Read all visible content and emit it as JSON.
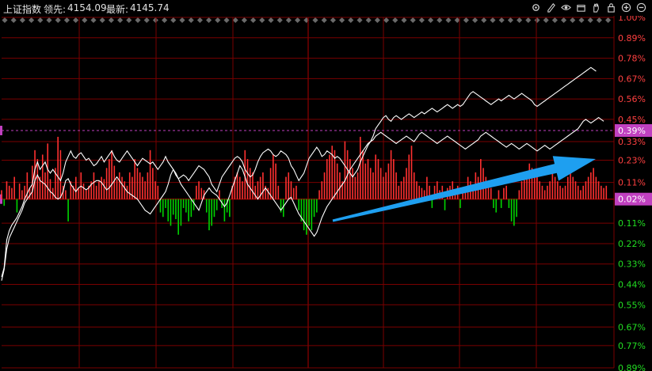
{
  "header": {
    "index_name": "上证指数",
    "lead_label": "领先:",
    "lead_value": "4154.09",
    "latest_label": "最新:",
    "latest_value": "4145.74"
  },
  "toolbar": {
    "icons": [
      "settings-icon",
      "pen-icon",
      "eye-icon",
      "box-icon",
      "hand-icon",
      "lock-icon",
      "zoom-in-icon",
      "zoom-out-icon"
    ]
  },
  "colors": {
    "background": "#000000",
    "grid": "#7a0000",
    "up": "#ff3030",
    "down": "#00d400",
    "line": "#ffffff",
    "marker": "#c040c0",
    "arrow": "#1e9ff0"
  },
  "chart_data": {
    "type": "line",
    "right_axis_labels": [
      "1.00%",
      "0.89%",
      "0.78%",
      "0.67%",
      "0.56%",
      "0.45%",
      "0.33%",
      "0.23%",
      "0.11%",
      "0.02%",
      "0.11%",
      "0.22%",
      "0.33%",
      "0.44%",
      "0.55%",
      "0.67%",
      "0.77%",
      "0.89%"
    ],
    "right_axis_values": [
      1.0,
      0.89,
      0.78,
      0.67,
      0.56,
      0.45,
      0.33,
      0.23,
      0.11,
      0.02,
      -0.11,
      -0.22,
      -0.33,
      -0.44,
      -0.55,
      -0.67,
      -0.77,
      -0.89
    ],
    "ylim": [
      -0.89,
      1.0
    ],
    "highlight_labels": [
      {
        "text": "0.39%",
        "value": 0.39
      },
      {
        "text": "0.02%",
        "value": 0.02
      }
    ],
    "x_points": 240,
    "series": [
      {
        "values": [
          -0.4,
          -0.35,
          -0.2,
          -0.15,
          -0.12,
          -0.1,
          -0.08,
          -0.05,
          -0.02,
          0.02,
          0.05,
          0.08,
          0.1,
          0.18,
          0.22,
          0.18,
          0.2,
          0.22,
          0.18,
          0.16,
          0.18,
          0.16,
          0.14,
          0.12,
          0.16,
          0.22,
          0.25,
          0.28,
          0.25,
          0.24,
          0.26,
          0.27,
          0.25,
          0.23,
          0.24,
          0.22,
          0.2,
          0.21,
          0.23,
          0.25,
          0.22,
          0.24,
          0.26,
          0.28,
          0.25,
          0.23,
          0.22,
          0.24,
          0.26,
          0.28,
          0.26,
          0.24,
          0.22,
          0.2,
          0.22,
          0.24,
          0.23,
          0.22,
          0.21,
          0.22,
          0.2,
          0.18,
          0.2,
          0.22,
          0.25,
          0.22,
          0.2,
          0.18,
          0.15,
          0.13,
          0.14,
          0.15,
          0.14,
          0.12,
          0.14,
          0.16,
          0.18,
          0.2,
          0.19,
          0.18,
          0.16,
          0.14,
          0.1,
          0.08,
          0.06,
          0.1,
          0.14,
          0.16,
          0.18,
          0.2,
          0.22,
          0.24,
          0.25,
          0.24,
          0.22,
          0.18,
          0.16,
          0.14,
          0.15,
          0.18,
          0.22,
          0.25,
          0.27,
          0.28,
          0.29,
          0.28,
          0.26,
          0.25,
          0.26,
          0.28,
          0.27,
          0.26,
          0.24,
          0.2,
          0.18,
          0.15,
          0.12,
          0.14,
          0.16,
          0.2,
          0.24,
          0.26,
          0.28,
          0.3,
          0.28,
          0.25,
          0.26,
          0.28,
          0.27,
          0.26,
          0.24,
          0.25,
          0.24,
          0.22,
          0.2,
          0.18,
          0.16,
          0.14,
          0.16,
          0.18,
          0.22,
          0.25,
          0.28,
          0.31,
          0.33,
          0.36,
          0.4,
          0.42,
          0.44,
          0.46,
          0.47,
          0.45,
          0.44,
          0.46,
          0.47,
          0.46,
          0.45,
          0.46,
          0.47,
          0.48,
          0.47,
          0.46,
          0.47,
          0.48,
          0.49,
          0.48,
          0.49,
          0.5,
          0.51,
          0.5,
          0.49,
          0.5,
          0.51,
          0.52,
          0.53,
          0.52,
          0.51,
          0.52,
          0.53,
          0.52,
          0.53,
          0.55,
          0.57,
          0.59,
          0.6,
          0.59,
          0.58,
          0.57,
          0.56,
          0.55,
          0.54,
          0.53,
          0.54,
          0.55,
          0.56,
          0.55,
          0.56,
          0.57,
          0.58,
          0.57,
          0.56,
          0.57,
          0.58,
          0.59,
          0.58,
          0.57,
          0.56,
          0.55,
          0.53,
          0.52,
          0.53,
          0.54,
          0.55,
          0.56,
          0.57,
          0.58,
          0.59,
          0.6,
          0.61,
          0.62,
          0.63,
          0.64,
          0.65,
          0.66,
          0.67,
          0.68,
          0.69,
          0.7,
          0.71,
          0.72,
          0.73,
          0.72,
          0.71
        ]
      },
      {
        "values": [
          -0.42,
          -0.36,
          -0.25,
          -0.19,
          -0.16,
          -0.13,
          -0.1,
          -0.07,
          -0.04,
          0.0,
          0.02,
          0.04,
          0.06,
          0.12,
          0.15,
          0.12,
          0.11,
          0.1,
          0.08,
          0.06,
          0.05,
          0.03,
          0.02,
          0.03,
          0.06,
          0.12,
          0.13,
          0.1,
          0.08,
          0.06,
          0.08,
          0.09,
          0.08,
          0.07,
          0.08,
          0.1,
          0.11,
          0.12,
          0.12,
          0.11,
          0.09,
          0.07,
          0.08,
          0.1,
          0.12,
          0.14,
          0.12,
          0.1,
          0.08,
          0.06,
          0.05,
          0.04,
          0.03,
          0.02,
          0.0,
          -0.02,
          -0.04,
          -0.05,
          -0.06,
          -0.04,
          -0.02,
          0.0,
          0.02,
          0.04,
          0.06,
          0.1,
          0.15,
          0.18,
          0.16,
          0.13,
          0.1,
          0.08,
          0.06,
          0.04,
          0.02,
          0.0,
          -0.02,
          -0.04,
          0.0,
          0.04,
          0.06,
          0.08,
          0.06,
          0.05,
          0.04,
          0.02,
          0.0,
          -0.02,
          0.0,
          0.04,
          0.08,
          0.12,
          0.16,
          0.2,
          0.18,
          0.14,
          0.1,
          0.08,
          0.06,
          0.04,
          0.02,
          0.04,
          0.06,
          0.08,
          0.06,
          0.04,
          0.02,
          0.0,
          -0.02,
          -0.04,
          -0.02,
          0.0,
          0.02,
          0.03,
          0.0,
          -0.03,
          -0.06,
          -0.08,
          -0.1,
          -0.12,
          -0.14,
          -0.16,
          -0.18,
          -0.16,
          -0.12,
          -0.08,
          -0.05,
          -0.02,
          0.0,
          0.02,
          0.04,
          0.06,
          0.08,
          0.1,
          0.12,
          0.15,
          0.18,
          0.2,
          0.22,
          0.24,
          0.26,
          0.28,
          0.3,
          0.32,
          0.33,
          0.34,
          0.36,
          0.37,
          0.38,
          0.37,
          0.36,
          0.35,
          0.34,
          0.33,
          0.32,
          0.33,
          0.34,
          0.35,
          0.36,
          0.35,
          0.34,
          0.33,
          0.35,
          0.37,
          0.38,
          0.37,
          0.36,
          0.35,
          0.34,
          0.33,
          0.32,
          0.33,
          0.34,
          0.35,
          0.36,
          0.35,
          0.34,
          0.33,
          0.32,
          0.31,
          0.3,
          0.29,
          0.3,
          0.31,
          0.32,
          0.33,
          0.34,
          0.36,
          0.37,
          0.38,
          0.37,
          0.36,
          0.35,
          0.34,
          0.33,
          0.32,
          0.31,
          0.3,
          0.31,
          0.32,
          0.31,
          0.3,
          0.29,
          0.3,
          0.31,
          0.32,
          0.31,
          0.3,
          0.29,
          0.28,
          0.29,
          0.3,
          0.31,
          0.3,
          0.29,
          0.3,
          0.31,
          0.32,
          0.33,
          0.34,
          0.35,
          0.36,
          0.37,
          0.38,
          0.39,
          0.4,
          0.42,
          0.44,
          0.45,
          0.44,
          0.43,
          0.44,
          0.45,
          0.46,
          0.45,
          0.44
        ]
      }
    ],
    "volume_bars": [
      0.04,
      -0.03,
      0.08,
      0.06,
      0.05,
      0.1,
      -0.06,
      0.07,
      0.04,
      0.06,
      0.12,
      0.05,
      0.15,
      0.22,
      0.18,
      0.1,
      0.2,
      0.12,
      0.25,
      0.09,
      0.05,
      0.14,
      0.28,
      0.22,
      0.06,
      0.04,
      -0.1,
      0.08,
      0.06,
      0.1,
      0.05,
      0.12,
      0.07,
      0.04,
      0.06,
      0.08,
      0.12,
      0.06,
      0.08,
      0.1,
      0.09,
      0.14,
      0.18,
      0.22,
      0.15,
      0.09,
      0.12,
      0.1,
      0.08,
      0.06,
      0.12,
      0.1,
      0.18,
      0.14,
      0.12,
      0.1,
      0.08,
      0.12,
      0.22,
      0.14,
      0.08,
      0.06,
      -0.06,
      -0.08,
      -0.04,
      -0.1,
      -0.12,
      -0.07,
      -0.09,
      -0.16,
      -0.12,
      -0.04,
      -0.06,
      -0.1,
      -0.08,
      -0.05,
      0.06,
      0.08,
      0.05,
      0.04,
      -0.06,
      -0.14,
      -0.12,
      -0.08,
      -0.05,
      0.04,
      -0.04,
      -0.1,
      -0.06,
      -0.08,
      0.06,
      0.1,
      0.12,
      0.1,
      0.08,
      0.22,
      0.18,
      0.14,
      0.12,
      0.06,
      0.08,
      0.1,
      0.12,
      0.06,
      0.05,
      0.14,
      0.2,
      0.16,
      0.06,
      -0.06,
      -0.08,
      0.1,
      0.12,
      0.08,
      0.05,
      0.06,
      -0.05,
      -0.1,
      -0.14,
      -0.16,
      -0.12,
      -0.14,
      -0.08,
      -0.06,
      0.04,
      0.08,
      0.12,
      0.18,
      0.2,
      0.24,
      0.22,
      0.16,
      0.12,
      0.08,
      0.26,
      0.22,
      0.18,
      0.14,
      0.1,
      0.12,
      0.28,
      0.22,
      0.16,
      0.18,
      0.14,
      0.12,
      0.2,
      0.18,
      0.14,
      0.1,
      0.12,
      0.16,
      0.22,
      0.18,
      0.12,
      0.06,
      0.08,
      0.1,
      0.14,
      0.2,
      0.24,
      0.12,
      0.08,
      0.06,
      0.05,
      0.04,
      0.1,
      0.06,
      -0.04,
      0.06,
      0.08,
      0.04,
      0.06,
      -0.05,
      0.05,
      0.06,
      0.08,
      0.04,
      0.06,
      -0.04,
      0.05,
      0.04,
      0.1,
      0.08,
      0.06,
      0.12,
      0.1,
      0.18,
      0.14,
      0.1,
      0.06,
      0.05,
      -0.04,
      -0.06,
      0.04,
      -0.04,
      0.05,
      0.06,
      -0.04,
      -0.1,
      -0.12,
      -0.08,
      0.04,
      0.08,
      0.1,
      0.12,
      0.16,
      0.14,
      0.12,
      0.1,
      0.08,
      0.06,
      0.04,
      0.06,
      0.08,
      0.12,
      0.1,
      0.08,
      0.06,
      0.05,
      0.06,
      0.1,
      0.12,
      0.1,
      0.08,
      0.06,
      0.04,
      0.06,
      0.08,
      0.1,
      0.12,
      0.14,
      0.1,
      0.08,
      0.06,
      0.05,
      0.06
    ]
  }
}
